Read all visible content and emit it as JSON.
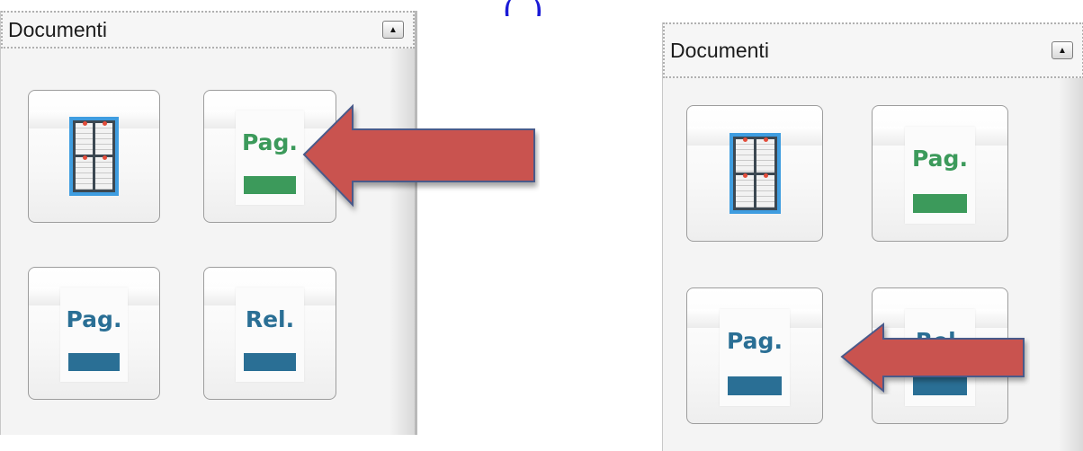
{
  "panels": [
    {
      "title": "Documenti",
      "tiles": [
        {
          "kind": "board",
          "icon": "bulletin-board-icon"
        },
        {
          "kind": "page",
          "label": "Pag.",
          "color": "#3c9a5b",
          "icon": "page-green-icon"
        },
        {
          "kind": "page",
          "label": "Pag.",
          "color": "#2a6f95",
          "icon": "page-blue-icon"
        },
        {
          "kind": "page",
          "label": "Rel.",
          "color": "#2a6f95",
          "icon": "relation-blue-icon"
        }
      ]
    },
    {
      "title": "Documenti",
      "tiles": [
        {
          "kind": "board",
          "icon": "bulletin-board-icon"
        },
        {
          "kind": "page",
          "label": "Pag.",
          "color": "#3c9a5b",
          "icon": "page-green-icon"
        },
        {
          "kind": "page",
          "label": "Pag.",
          "color": "#2a6f95",
          "icon": "page-blue-icon"
        },
        {
          "kind": "page",
          "label": "Rel.",
          "color": "#2a6f95",
          "icon": "relation-blue-icon"
        }
      ]
    }
  ],
  "colors": {
    "arrow": "#c9524f",
    "arrow_outline": "#4a5a8a",
    "board_frame": "#3f9de0",
    "green": "#3c9a5b",
    "blue": "#2a6f95"
  }
}
